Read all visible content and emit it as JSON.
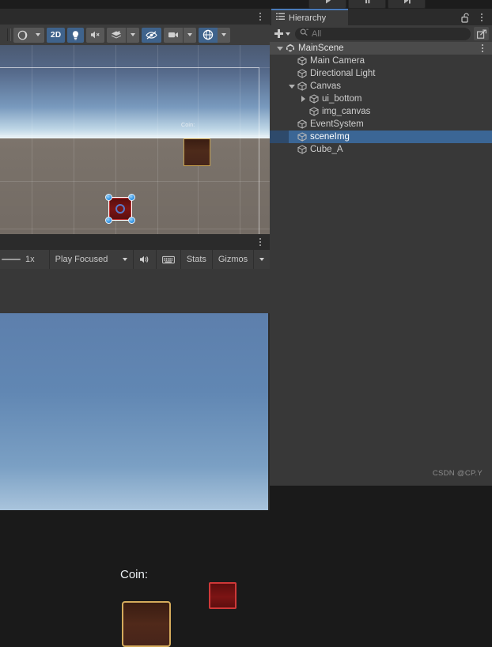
{
  "topbar": {
    "play_label": "play-button",
    "pause_label": "pause-button",
    "step_label": "step-button"
  },
  "scene_panel": {
    "toolbar": {
      "shading_mode": "shaded-sphere-icon",
      "mode_2d": "2D",
      "lighting": "lightbulb-icon",
      "audio": "audio-muted-icon",
      "effects": "effects-layers-icon",
      "hidden_objects": "eye-crossed-icon",
      "camera": "camera-icon",
      "gizmos": "scene-gizmo-icon"
    },
    "viewport": {
      "coin_label": "Coin:",
      "sky_color": "#6d8cb0",
      "ground_color": "#786f68",
      "brown_box_fill": "#4a2719",
      "brown_box_border": "#c8a24e",
      "red_box_fill": "#7a1414",
      "red_box_border": "#c03030",
      "handle_color": "#3a9ae8",
      "selection_outline": "#ffffff"
    }
  },
  "game_panel": {
    "toolbar": {
      "scale_value": "1x",
      "play_mode": "Play Focused",
      "mute_audio": "audio-icon",
      "stats_toggle": "Stats",
      "gizmos_toggle": "Gizmos",
      "keyboard_icon": "keyboard-icon"
    },
    "viewport": {
      "coin_label": "Coin:",
      "background_top": "#5d7fac",
      "background_bottom": "#a9c4dc",
      "brown_box_fill": "#4b2619",
      "brown_box_border": "#d4ab5c",
      "red_box_fill": "#7c1414",
      "red_box_border": "#cf3838"
    }
  },
  "hierarchy": {
    "tab_label": "Hierarchy",
    "tab_icon": "hierarchy-list-icon",
    "lock_icon": "padlock-open-icon",
    "menu_icon": "kebab-menu-icon",
    "add_label": "add-object-button",
    "search": {
      "placeholder": "All",
      "value": "",
      "icon": "search-icon"
    },
    "expand_icon": "expand-search-icon",
    "selection_color": "#3b6695",
    "tree": [
      {
        "label": "MainScene",
        "indent": 0,
        "twisty": "down",
        "icon": "unity-scene-icon",
        "kind": "scene",
        "selected": false
      },
      {
        "label": "Main Camera",
        "indent": 1,
        "twisty": "none",
        "icon": "gameobject-cube-icon",
        "kind": "object",
        "selected": false
      },
      {
        "label": "Directional Light",
        "indent": 1,
        "twisty": "none",
        "icon": "gameobject-cube-icon",
        "kind": "object",
        "selected": false
      },
      {
        "label": "Canvas",
        "indent": 1,
        "twisty": "down",
        "icon": "gameobject-cube-icon",
        "kind": "object",
        "selected": false
      },
      {
        "label": "ui_bottom",
        "indent": 2,
        "twisty": "right",
        "icon": "gameobject-cube-icon",
        "kind": "object",
        "selected": false
      },
      {
        "label": "img_canvas",
        "indent": 2,
        "twisty": "none",
        "icon": "gameobject-cube-icon",
        "kind": "object",
        "selected": false
      },
      {
        "label": "EventSystem",
        "indent": 1,
        "twisty": "none",
        "icon": "gameobject-cube-icon",
        "kind": "object",
        "selected": false
      },
      {
        "label": "sceneImg",
        "indent": 1,
        "twisty": "none",
        "icon": "gameobject-cube-icon",
        "kind": "object",
        "selected": true
      },
      {
        "label": "Cube_A",
        "indent": 1,
        "twisty": "none",
        "icon": "gameobject-cube-icon",
        "kind": "object",
        "selected": false
      }
    ]
  },
  "watermark": {
    "text": "CSDN @CP.Y"
  }
}
